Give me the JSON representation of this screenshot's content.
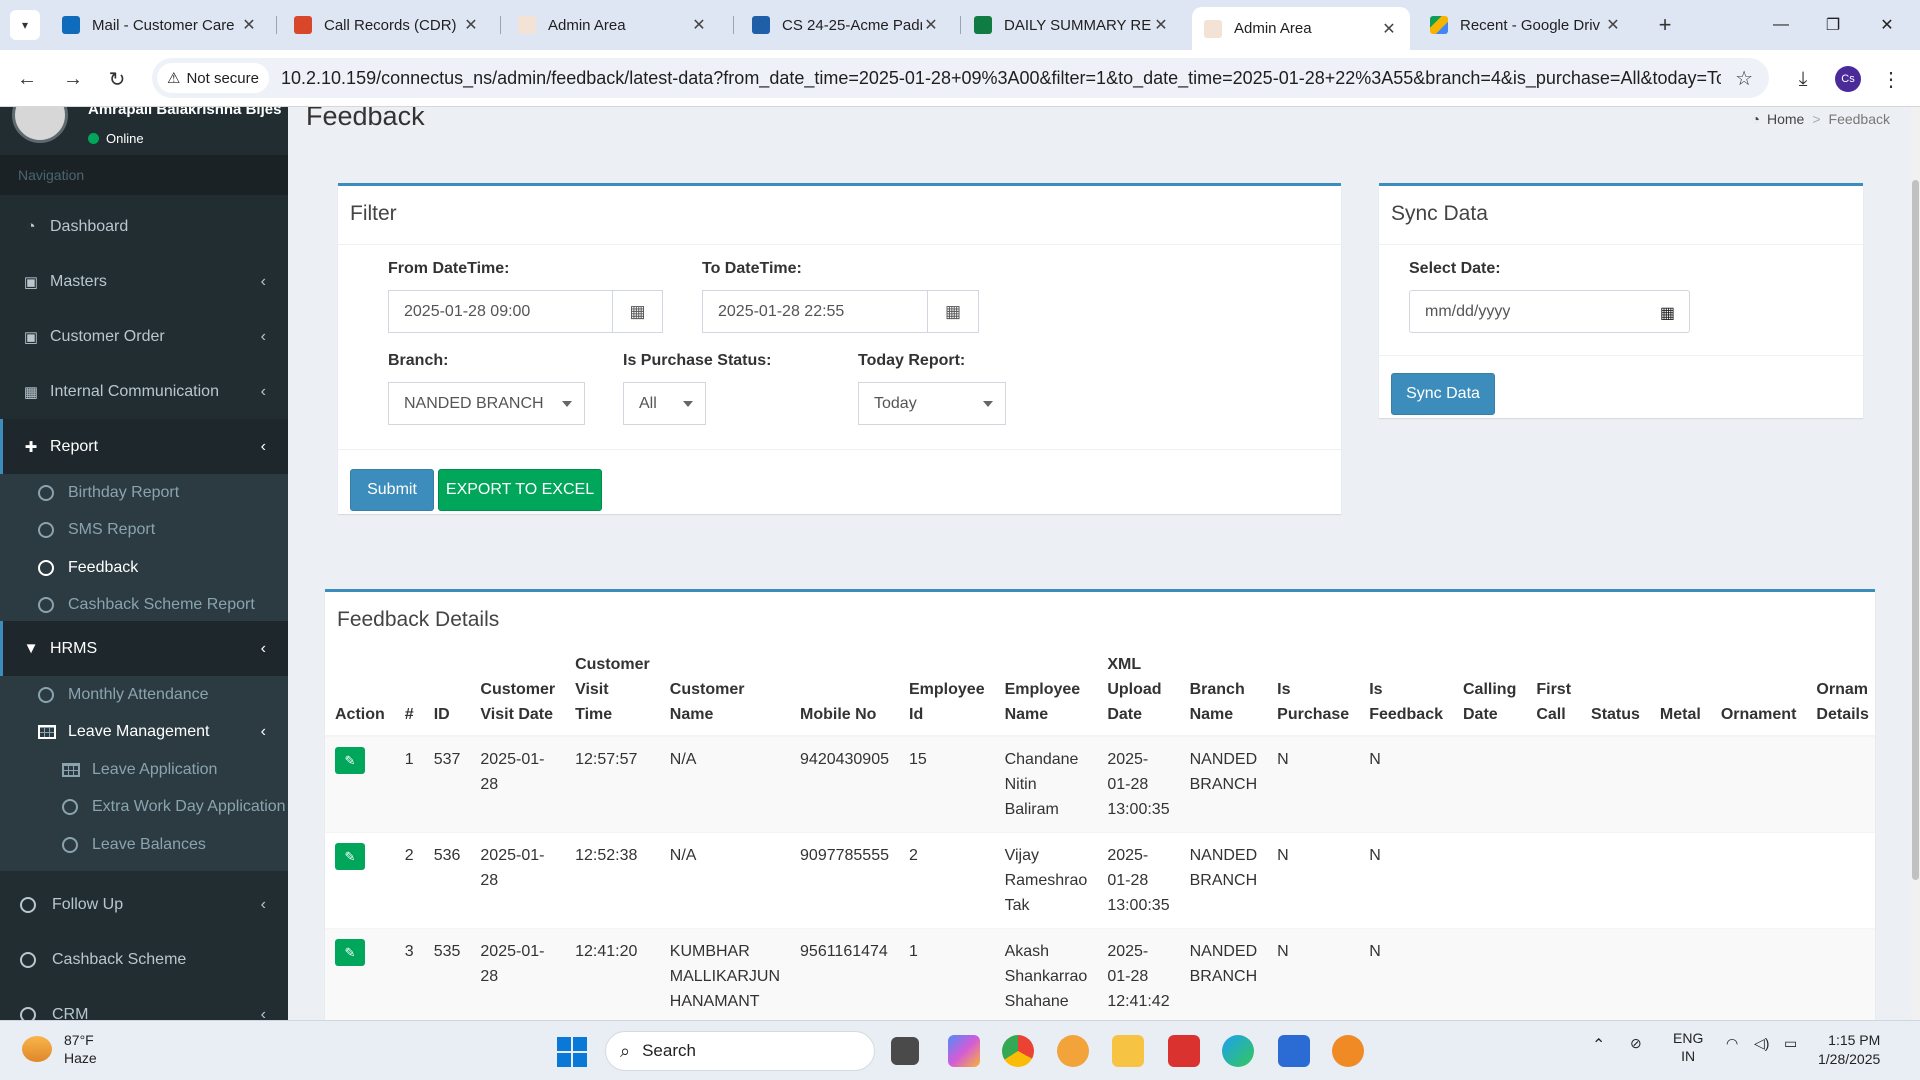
{
  "browser": {
    "tabs": [
      {
        "title": "Mail - Customer Care",
        "color": "#0f6cbd"
      },
      {
        "title": "Call Records (CDR)",
        "color": "#d9472b"
      },
      {
        "title": "Admin Area",
        "color": "#e9c7b0"
      },
      {
        "title": "CS 24-25-Acme Padr",
        "color": "#1f5fa8"
      },
      {
        "title": "DAILY SUMMARY RE",
        "color": "#107c41"
      },
      {
        "title": "Admin Area",
        "color": "#e9c7b0"
      },
      {
        "title": "Recent - Google Driv",
        "color": "#f4b400"
      }
    ],
    "not_secure": "Not secure",
    "url": "10.2.10.159/connectus_ns/admin/feedback/latest-data?from_date_time=2025-01-28+09%3A00&filter=1&to_date_time=2025-01-28+22%3A55&branch=4&is_purchase=All&today=To...",
    "profile_initials": "Cs"
  },
  "sidebar": {
    "user_name": "Amrapali Balakrishna Bijes",
    "status": "Online",
    "nav_header": "Navigation",
    "items": {
      "dashboard": "Dashboard",
      "masters": "Masters",
      "customer_order": "Customer Order",
      "internal_communication": "Internal Communication",
      "report": "Report",
      "birthday_report": "Birthday Report",
      "sms_report": "SMS Report",
      "feedback": "Feedback",
      "cashback_scheme_report": "Cashback Scheme Report",
      "hrms": "HRMS",
      "monthly_attendance": "Monthly Attendance",
      "leave_management": "Leave Management",
      "leave_application": "Leave Application",
      "extra_work_day_application": "Extra Work Day Application",
      "leave_balances": "Leave Balances",
      "follow_up": "Follow Up",
      "cashback_scheme": "Cashback Scheme",
      "crm": "CRM"
    }
  },
  "page": {
    "title": "Feedback",
    "breadcrumb_home": "Home",
    "breadcrumb_current": "Feedback"
  },
  "filter": {
    "title": "Filter",
    "from_label": "From DateTime:",
    "from_value": "2025-01-28 09:00",
    "to_label": "To DateTime:",
    "to_value": "2025-01-28 22:55",
    "branch_label": "Branch:",
    "branch_value": "NANDED BRANCH",
    "purchase_label": "Is Purchase Status:",
    "purchase_value": "All",
    "today_label": "Today Report:",
    "today_value": "Today",
    "submit": "Submit",
    "export": "EXPORT TO EXCEL"
  },
  "sync": {
    "title": "Sync Data",
    "date_label": "Select Date:",
    "date_placeholder": "mm/dd/yyyy",
    "button": "Sync Data"
  },
  "details": {
    "title": "Feedback Details",
    "headers": [
      "Action",
      "#",
      "ID",
      "Customer Visit Date",
      "Customer Visit Time",
      "Customer Name",
      "Mobile No",
      "Employee Id",
      "Employee Name",
      "XML Upload Date",
      "Branch Name",
      "Is Purchase",
      "Is Feedback",
      "Calling Date",
      "First Call",
      "Status",
      "Metal",
      "Ornament",
      "Ornam Details"
    ],
    "rows": [
      {
        "n": "1",
        "id": "537",
        "visit_date": "2025-01-28",
        "visit_time": "12:57:57",
        "customer": "N/A",
        "mobile": "9420430905",
        "emp_id": "15",
        "emp_name": "Chandane Nitin Baliram",
        "xml_date": "2025-01-28 13:00:35",
        "branch": "NANDED BRANCH",
        "purchase": "N",
        "feedback": "N"
      },
      {
        "n": "2",
        "id": "536",
        "visit_date": "2025-01-28",
        "visit_time": "12:52:38",
        "customer": "N/A",
        "mobile": "9097785555",
        "emp_id": "2",
        "emp_name": "Vijay Rameshrao Tak",
        "xml_date": "2025-01-28 13:00:35",
        "branch": "NANDED BRANCH",
        "purchase": "N",
        "feedback": "N"
      },
      {
        "n": "3",
        "id": "535",
        "visit_date": "2025-01-28",
        "visit_time": "12:41:20",
        "customer": "KUMBHAR MALLIKARJUN HANAMANT",
        "mobile": "9561161474",
        "emp_id": "1",
        "emp_name": "Akash Shankarrao Shahane",
        "xml_date": "2025-01-28 12:41:42",
        "branch": "NANDED BRANCH",
        "purchase": "N",
        "feedback": "N"
      }
    ]
  },
  "taskbar": {
    "temp": "87°F",
    "weather": "Haze",
    "search": "Search",
    "lang1": "ENG",
    "lang2": "IN",
    "time": "1:15 PM",
    "date": "1/28/2025"
  }
}
